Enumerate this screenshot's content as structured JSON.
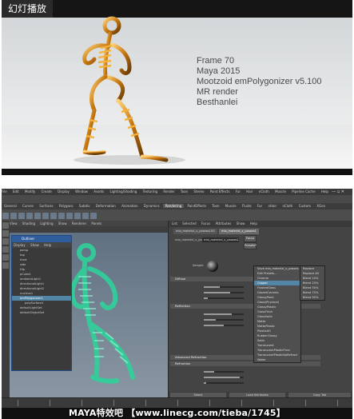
{
  "top_panel": {
    "tag": "幻灯播放",
    "info_lines": [
      "Frame 70",
      "Maya 2015",
      "Mootzoid emPolygonizer v5.100",
      "MR render",
      "Besthanlei"
    ]
  },
  "maya": {
    "menu": [
      "File",
      "Edit",
      "Modify",
      "Create",
      "Display",
      "Window",
      "Assets",
      "Lighting/Shading",
      "Texturing",
      "Render",
      "Toon",
      "Stereo",
      "Paint Effects",
      "Fur",
      "Hair",
      "nCloth",
      "Muscle",
      "Pipeline Cache",
      "Help"
    ],
    "shelf_tabs": [
      "General",
      "Curves",
      "Surfaces",
      "Polygons",
      "Subdiv",
      "Deformation",
      "Animation",
      "Dynamics",
      "Rendering",
      "PaintEffects",
      "Toon",
      "Muscle",
      "Fluids",
      "Fur",
      "nHair",
      "nCloth",
      "Custom",
      "XGen"
    ],
    "shelf_active": "Rendering",
    "viewport_menu": [
      "View",
      "Shading",
      "Lighting",
      "Show",
      "Renderer",
      "Panels"
    ],
    "outliner": {
      "title": "Outliner",
      "menu": [
        "Display",
        "Show",
        "Help"
      ],
      "rows": [
        {
          "label": "persp",
          "indent": false,
          "selected": false
        },
        {
          "label": "top",
          "indent": false,
          "selected": false
        },
        {
          "label": "front",
          "indent": false,
          "selected": false
        },
        {
          "label": "side",
          "indent": false,
          "selected": false
        },
        {
          "label": "Hip",
          "indent": false,
          "selected": false
        },
        {
          "label": "pCube1",
          "indent": false,
          "selected": false
        },
        {
          "label": "ambientLight1",
          "indent": false,
          "selected": false
        },
        {
          "label": "directionalLight1",
          "indent": false,
          "selected": false
        },
        {
          "label": "directionalLight2",
          "indent": false,
          "selected": false
        },
        {
          "label": "nucleus1",
          "indent": false,
          "selected": false
        },
        {
          "label": "emPolygonizer1",
          "indent": false,
          "selected": true
        },
        {
          "label": "polySurface1",
          "indent": true,
          "selected": false
        },
        {
          "label": "defaultLightSet",
          "indent": false,
          "selected": false
        },
        {
          "label": "defaultObjectSet",
          "indent": false,
          "selected": false
        }
      ]
    },
    "attribute_editor": {
      "header": [
        "List",
        "Selected",
        "Focus",
        "Attributes",
        "Show",
        "Help"
      ],
      "tabs": [
        "mia_material_x_passes1SG",
        "mia_material_x_passes1"
      ],
      "active_tab": "mia_material_x_passes1",
      "type_label": "mia_material_x_passes",
      "name_field": "mia_material_x_passes1",
      "focus_button": "Focus",
      "presets_button": "Presets*",
      "sample_label": "Sample",
      "sections": [
        "Diffuse",
        "Reflection",
        "Advanced Refraction",
        "Refraction"
      ],
      "context_menu": [
        "Save mia_material_x_passes Preset...",
        "Edit Presets...",
        "Chrome",
        "Copper",
        "FrostedGlass",
        "GlazedCeramic",
        "GlossyPaint",
        "Glass(Physical)",
        "GlossyPlastic",
        "GlassThick",
        "GlassSolid",
        "Matte",
        "MattePlastic",
        "PlasticAO",
        "RubberGlossy",
        "Satin",
        "Translucent",
        "TranslucentPlasticFlexi",
        "TranslucentPlasticNoRefract",
        "Water"
      ],
      "context_highlight": "Copper",
      "submenu": [
        "Replace",
        "Replace All",
        "Blend 10%",
        "Blend 25%",
        "Blend 50%",
        "Blend 75%",
        "Blend 90%"
      ],
      "notes_label": "Notes: mia_material_x_passes1",
      "bottom_buttons": [
        "Select",
        "Load Attributes",
        "Copy Tab"
      ]
    }
  },
  "watermark": "MAYA特效吧 【www.linecg.com/tieba/1745】"
}
